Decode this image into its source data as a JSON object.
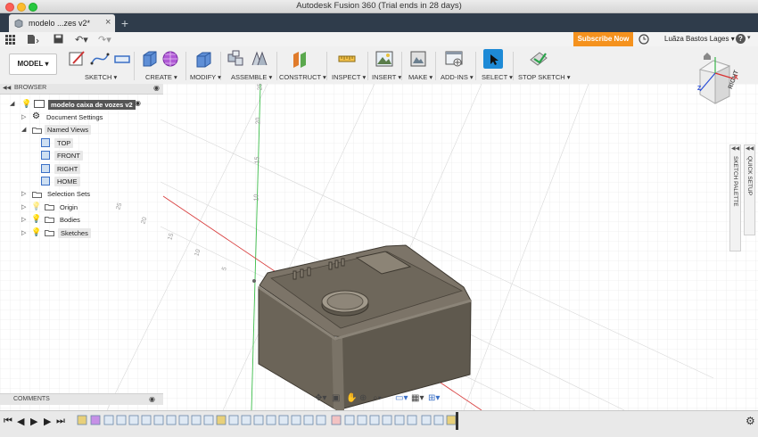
{
  "window": {
    "title": "Autodesk Fusion 360 (Trial ends in 28 days)"
  },
  "tab": {
    "label": "modelo ...zes v2*",
    "close": "×",
    "new": "+"
  },
  "menubar": {
    "subscribe": "Subscribe Now",
    "user": "Luãza Bastos Lages ▾",
    "help": "?",
    "icons": [
      "grid-icon",
      "file-icon",
      "save-icon",
      "undo-icon",
      "redo-icon"
    ]
  },
  "toolbar": {
    "model": "MODEL ▾",
    "groups": [
      {
        "label": "SKETCH ▾"
      },
      {
        "label": "CREATE ▾"
      },
      {
        "label": "MODIFY ▾"
      },
      {
        "label": "ASSEMBLE ▾"
      },
      {
        "label": "CONSTRUCT ▾"
      },
      {
        "label": "INSPECT ▾"
      },
      {
        "label": "INSERT ▾"
      },
      {
        "label": "MAKE ▾"
      },
      {
        "label": "ADD-INS ▾"
      },
      {
        "label": "SELECT ▾"
      },
      {
        "label": "STOP SKETCH ▾"
      }
    ]
  },
  "browser": {
    "header": "BROWSER",
    "root": "modelo caixa de vozes v2",
    "items": [
      {
        "label": "Document Settings"
      },
      {
        "label": "Named Views"
      },
      {
        "label": "TOP"
      },
      {
        "label": "FRONT"
      },
      {
        "label": "RIGHT"
      },
      {
        "label": "HOME"
      },
      {
        "label": "Selection Sets"
      },
      {
        "label": "Origin"
      },
      {
        "label": "Bodies"
      },
      {
        "label": "Sketches"
      }
    ]
  },
  "comments": {
    "label": "COMMENTS"
  },
  "viewcube": {
    "face": "RIGHT",
    "x": "X",
    "z": "Z"
  },
  "side_panels": {
    "sketch_palette": "SKETCH PALETTE",
    "quick_setup": "QUICK SETUP"
  },
  "axis_ticks": {
    "vertical": [
      "25",
      "20",
      "15",
      "10"
    ],
    "horizontal": [
      "25",
      "20",
      "15",
      "10",
      "5"
    ]
  },
  "colors": {
    "accent": "#f5921e",
    "tabbar": "#2f3c4b",
    "body": "#6a6357",
    "select": "#1e8ad6"
  }
}
